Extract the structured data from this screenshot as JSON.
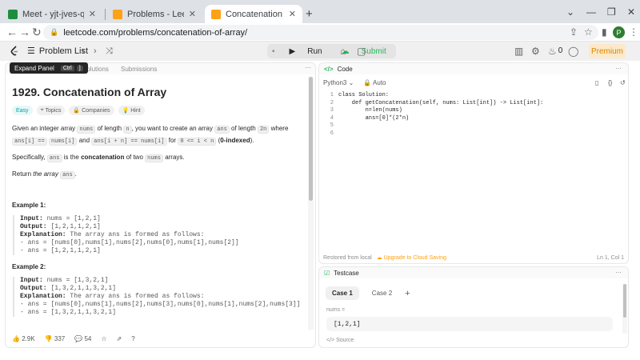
{
  "browser": {
    "tabs": [
      {
        "title": "Meet - yjt-jves-qza",
        "active": false,
        "favicon_color": "#1e8e3e"
      },
      {
        "title": "Problems - LeetCode",
        "active": false,
        "favicon_color": "#ffa116"
      },
      {
        "title": "Concatenation of Array - LeetCo",
        "active": true,
        "favicon_color": "#ffa116"
      }
    ],
    "url": "leetcode.com/problems/concatenation-of-array/",
    "profile_initial": "P"
  },
  "nav": {
    "problem_list": "Problem List",
    "run": "Run",
    "submit": "Submit",
    "streak": "0",
    "premium": "Premium"
  },
  "left": {
    "tooltip": "Expand Panel",
    "tooltip_key1": "Ctrl",
    "tooltip_key2": "]",
    "tab_solutions": "Solutions",
    "tab_submissions": "Submissions",
    "title": "1929. Concatenation of Array",
    "chip_easy": "Easy",
    "chip_topics": "Topics",
    "chip_companies": "Companies",
    "chip_hint": "Hint",
    "d1_a": "Given an integer array",
    "d1_nums": "nums",
    "d1_b": "of length",
    "d1_n": "n",
    "d1_c": ", you want to create an array",
    "d1_ans": "ans",
    "d1_d": "of length",
    "d1_2n": "2n",
    "d1_e": "where",
    "d1_ansi": "ans[i] ==",
    "d1_numsi": "nums[i]",
    "d1_f": "and",
    "d1_ansin": "ans[i + n] == nums[i]",
    "d1_g": "for",
    "d1_range": "0 <= i < n",
    "d1_h": "(",
    "d1_indexed": "0-indexed",
    "d1_i": ").",
    "d2_a": "Specifically,",
    "d2_ans": "ans",
    "d2_b": "is the",
    "d2_concat": "concatenation",
    "d2_c": "of two",
    "d2_nums": "nums",
    "d2_d": "arrays.",
    "d3_a": "Return",
    "d3_array": "the array",
    "d3_ans": "ans",
    "d3_b": ".",
    "ex1_title": "Example 1:",
    "ex1_input_label": "Input:",
    "ex1_input": "nums = [1,2,1]",
    "ex1_output_label": "Output:",
    "ex1_output": "[1,2,1,1,2,1]",
    "ex1_expl_label": "Explanation:",
    "ex1_expl": "The array ans is formed as follows:",
    "ex1_l1": "- ans = [nums[0],nums[1],nums[2],nums[0],nums[1],nums[2]]",
    "ex1_l2": "- ans = [1,2,1,1,2,1]",
    "ex2_title": "Example 2:",
    "ex2_input_label": "Input:",
    "ex2_input": "nums = [1,3,2,1]",
    "ex2_output_label": "Output:",
    "ex2_output": "[1,3,2,1,1,3,2,1]",
    "ex2_expl_label": "Explanation:",
    "ex2_expl": "The array ans is formed as follows:",
    "ex2_l1": "- ans = [nums[0],nums[1],nums[2],nums[3],nums[0],nums[1],nums[2],nums[3]]",
    "ex2_l2": "- ans = [1,3,2,1,1,3,2,1]",
    "likes": "2.9K",
    "dislikes": "337",
    "comments": "54"
  },
  "code": {
    "header": "Code",
    "language": "Python3",
    "auto": "Auto",
    "lines": [
      {
        "n": "1",
        "text": "class Solution:"
      },
      {
        "n": "2",
        "text": "    def getConcatenation(self, nums: List[int]) -> List[int]:"
      },
      {
        "n": "3",
        "text": "        n=len(nums)"
      },
      {
        "n": "4",
        "text": "        ans=[0]*(2*n)"
      },
      {
        "n": "5",
        "text": ""
      },
      {
        "n": "6",
        "text": ""
      }
    ],
    "restored": "Restored from local",
    "upgrade": "Upgrade to Cloud Saving",
    "position": "Ln 1, Col 1"
  },
  "testcase": {
    "header": "Testcase",
    "case1": "Case 1",
    "case2": "Case 2",
    "add": "+",
    "field_label": "nums =",
    "field_value": "[1,2,1]",
    "source": "Source"
  },
  "colors": {
    "accent": "#ffa116",
    "easy": "#00a3a3",
    "testcase_check": "#2db55d"
  }
}
